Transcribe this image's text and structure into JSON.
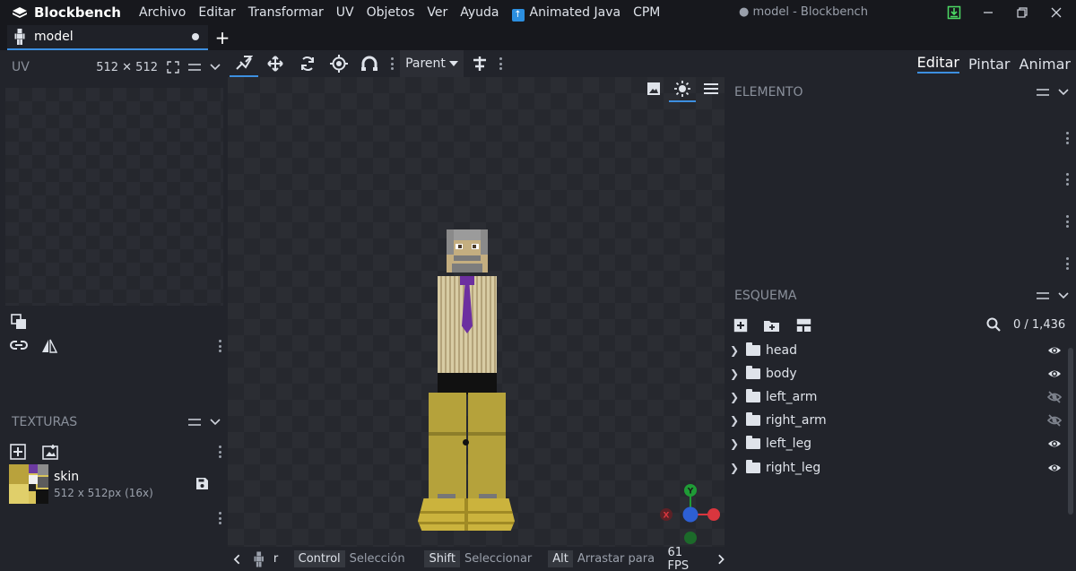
{
  "app": {
    "name": "Blockbench",
    "window_title": "● model - Blockbench"
  },
  "menu": [
    "Archivo",
    "Editar",
    "Transformar",
    "UV",
    "Objetos",
    "Ver",
    "Ayuda",
    "Animated Java",
    "CPM"
  ],
  "tab": {
    "label": "model"
  },
  "uv_panel": {
    "title": "UV",
    "size": "512 ✕ 512"
  },
  "textures_panel": {
    "title": "TEXTURAS",
    "item": {
      "name": "skin",
      "info": "512 x 512px (16x)"
    }
  },
  "viewport_toolbar": {
    "pivot_mode": "Parent"
  },
  "status": {
    "key1": "Control",
    "hint1": "Selección",
    "key2": "Shift",
    "hint2": "Seleccionar",
    "key3": "Alt",
    "hint3": "Arrastar para",
    "fps": "61 FPS",
    "partial": "r"
  },
  "modes": [
    "Editar",
    "Pintar",
    "Animar"
  ],
  "element_panel": {
    "title": "ELEMENTO"
  },
  "outliner": {
    "title": "ESQUEMA",
    "count": "0 / 1,436",
    "items": [
      {
        "name": "head",
        "visible": true
      },
      {
        "name": "body",
        "visible": true
      },
      {
        "name": "left_arm",
        "visible": false
      },
      {
        "name": "right_arm",
        "visible": false
      },
      {
        "name": "left_leg",
        "visible": true
      },
      {
        "name": "right_leg",
        "visible": true
      }
    ]
  },
  "colors": {
    "accent": "#3d8fe0",
    "gizmo_x": "#d9363e",
    "gizmo_y": "#1f9b36",
    "gizmo_z": "#2d5fd3"
  }
}
